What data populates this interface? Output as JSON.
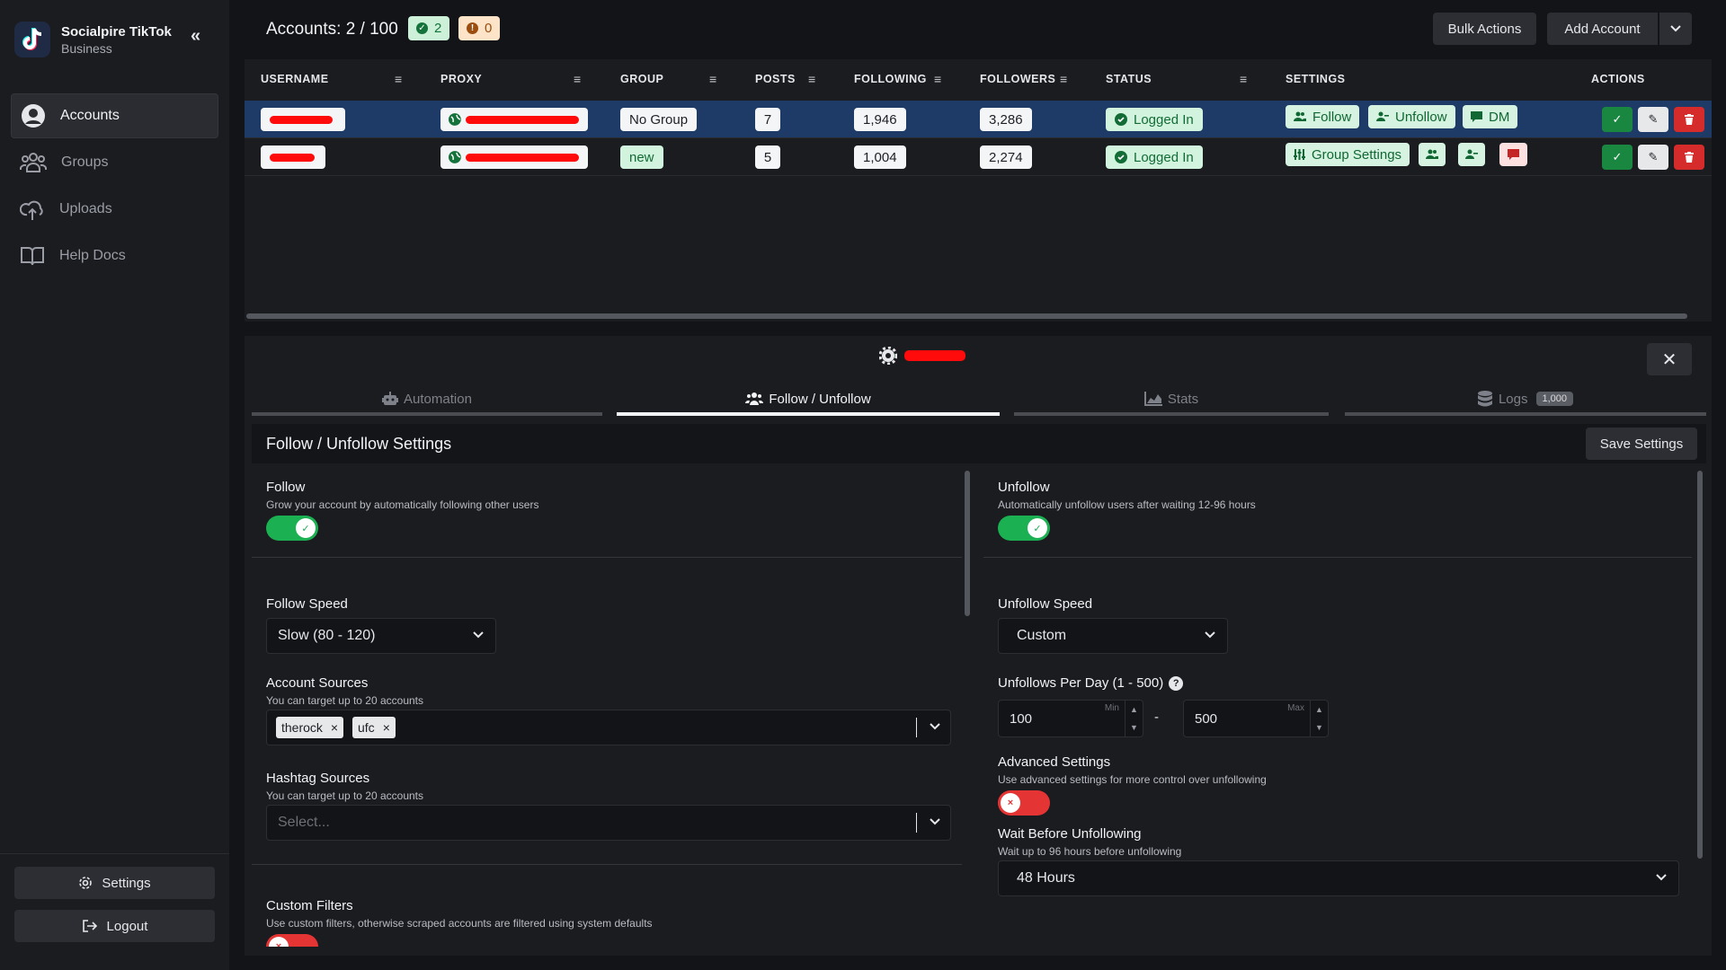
{
  "sidebar": {
    "brand_name": "Socialpire TikTok",
    "brand_sub": "Business",
    "items": [
      {
        "label": "Accounts"
      },
      {
        "label": "Groups"
      },
      {
        "label": "Uploads"
      },
      {
        "label": "Help Docs"
      }
    ],
    "settings_label": "Settings",
    "logout_label": "Logout"
  },
  "header": {
    "title": "Accounts: 2 / 100",
    "ok_count": "2",
    "warn_count": "0",
    "bulk_actions": "Bulk Actions",
    "add_account": "Add Account"
  },
  "table": {
    "columns": [
      "USERNAME",
      "PROXY",
      "GROUP",
      "POSTS",
      "FOLLOWING",
      "FOLLOWERS",
      "STATUS",
      "SETTINGS",
      "ACTIONS"
    ],
    "rows": [
      {
        "group": "No Group",
        "posts": "7",
        "following": "1,946",
        "followers": "3,286",
        "status": "Logged In",
        "settings": [
          "Follow",
          "Unfollow",
          "DM"
        ]
      },
      {
        "group": "new",
        "posts": "5",
        "following": "1,004",
        "followers": "2,274",
        "status": "Logged In",
        "settings": [
          "Group Settings"
        ]
      }
    ]
  },
  "detail": {
    "tabs": [
      {
        "label": "Automation"
      },
      {
        "label": "Follow / Unfollow"
      },
      {
        "label": "Stats"
      },
      {
        "label": "Logs",
        "badge": "1,000"
      }
    ],
    "section_title": "Follow / Unfollow Settings",
    "save_label": "Save Settings",
    "follow": {
      "label": "Follow",
      "desc": "Grow your account by automatically following other users",
      "enabled": true,
      "speed_label": "Follow Speed",
      "speed_value": "Slow (80 - 120)",
      "account_sources_label": "Account Sources",
      "account_sources_desc": "You can target up to 20 accounts",
      "account_sources": [
        "therock",
        "ufc"
      ],
      "hashtag_sources_label": "Hashtag Sources",
      "hashtag_sources_desc": "You can target up to 20 accounts",
      "hashtag_placeholder": "Select...",
      "custom_filters_label": "Custom Filters",
      "custom_filters_desc": "Use custom filters, otherwise scraped accounts are filtered using system defaults",
      "custom_filters_enabled": false
    },
    "unfollow": {
      "label": "Unfollow",
      "desc": "Automatically unfollow users after waiting 12-96 hours",
      "enabled": true,
      "speed_label": "Unfollow Speed",
      "speed_value": "Custom",
      "per_day_label": "Unfollows Per Day (1 - 500)",
      "min_value": "100",
      "min_hint": "Min",
      "max_value": "500",
      "max_hint": "Max",
      "range_sep": "-",
      "advanced_label": "Advanced Settings",
      "advanced_desc": "Use advanced settings for more control over unfollowing",
      "advanced_enabled": false,
      "wait_label": "Wait Before Unfollowing",
      "wait_desc": "Wait up to 96 hours before unfollowing",
      "wait_value": "48 Hours"
    }
  },
  "colors": {
    "accent_green": "#1bb052",
    "danger_red": "#e53434",
    "selected_row": "#1d3b66"
  }
}
